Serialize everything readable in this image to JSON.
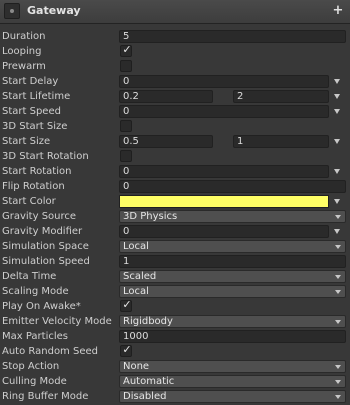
{
  "component": {
    "title": "Gateway",
    "icon": "particle-system-icon",
    "add_icon": "plus-icon",
    "add_symbol": "+"
  },
  "check_symbol": "✓",
  "props": {
    "duration": {
      "label": "Duration",
      "value": "5"
    },
    "looping": {
      "label": "Looping",
      "checked": true
    },
    "prewarm": {
      "label": "Prewarm",
      "checked": false
    },
    "start_delay": {
      "label": "Start Delay",
      "value": "0"
    },
    "start_lifetime": {
      "label": "Start Lifetime",
      "min": "0.2",
      "max": "2"
    },
    "start_speed": {
      "label": "Start Speed",
      "value": "0"
    },
    "start_size_3d": {
      "label": "3D Start Size",
      "checked": false
    },
    "start_size": {
      "label": "Start Size",
      "min": "0.5",
      "max": "1"
    },
    "start_rotation_3d": {
      "label": "3D Start Rotation",
      "checked": false
    },
    "start_rotation": {
      "label": "Start Rotation",
      "value": "0"
    },
    "flip_rotation": {
      "label": "Flip Rotation",
      "value": "0"
    },
    "start_color": {
      "label": "Start Color",
      "color": "#ffff66"
    },
    "gravity_source": {
      "label": "Gravity Source",
      "value": "3D Physics"
    },
    "gravity_modifier": {
      "label": "Gravity Modifier",
      "value": "0"
    },
    "simulation_space": {
      "label": "Simulation Space",
      "value": "Local"
    },
    "simulation_speed": {
      "label": "Simulation Speed",
      "value": "1"
    },
    "delta_time": {
      "label": "Delta Time",
      "value": "Scaled"
    },
    "scaling_mode": {
      "label": "Scaling Mode",
      "value": "Local"
    },
    "play_on_awake": {
      "label": "Play On Awake*",
      "checked": true
    },
    "emitter_velocity_mode": {
      "label": "Emitter Velocity Mode",
      "value": "Rigidbody"
    },
    "max_particles": {
      "label": "Max Particles",
      "value": "1000"
    },
    "auto_random_seed": {
      "label": "Auto Random Seed",
      "checked": true
    },
    "stop_action": {
      "label": "Stop Action",
      "value": "None"
    },
    "culling_mode": {
      "label": "Culling Mode",
      "value": "Automatic"
    },
    "ring_buffer_mode": {
      "label": "Ring Buffer Mode",
      "value": "Disabled"
    }
  }
}
